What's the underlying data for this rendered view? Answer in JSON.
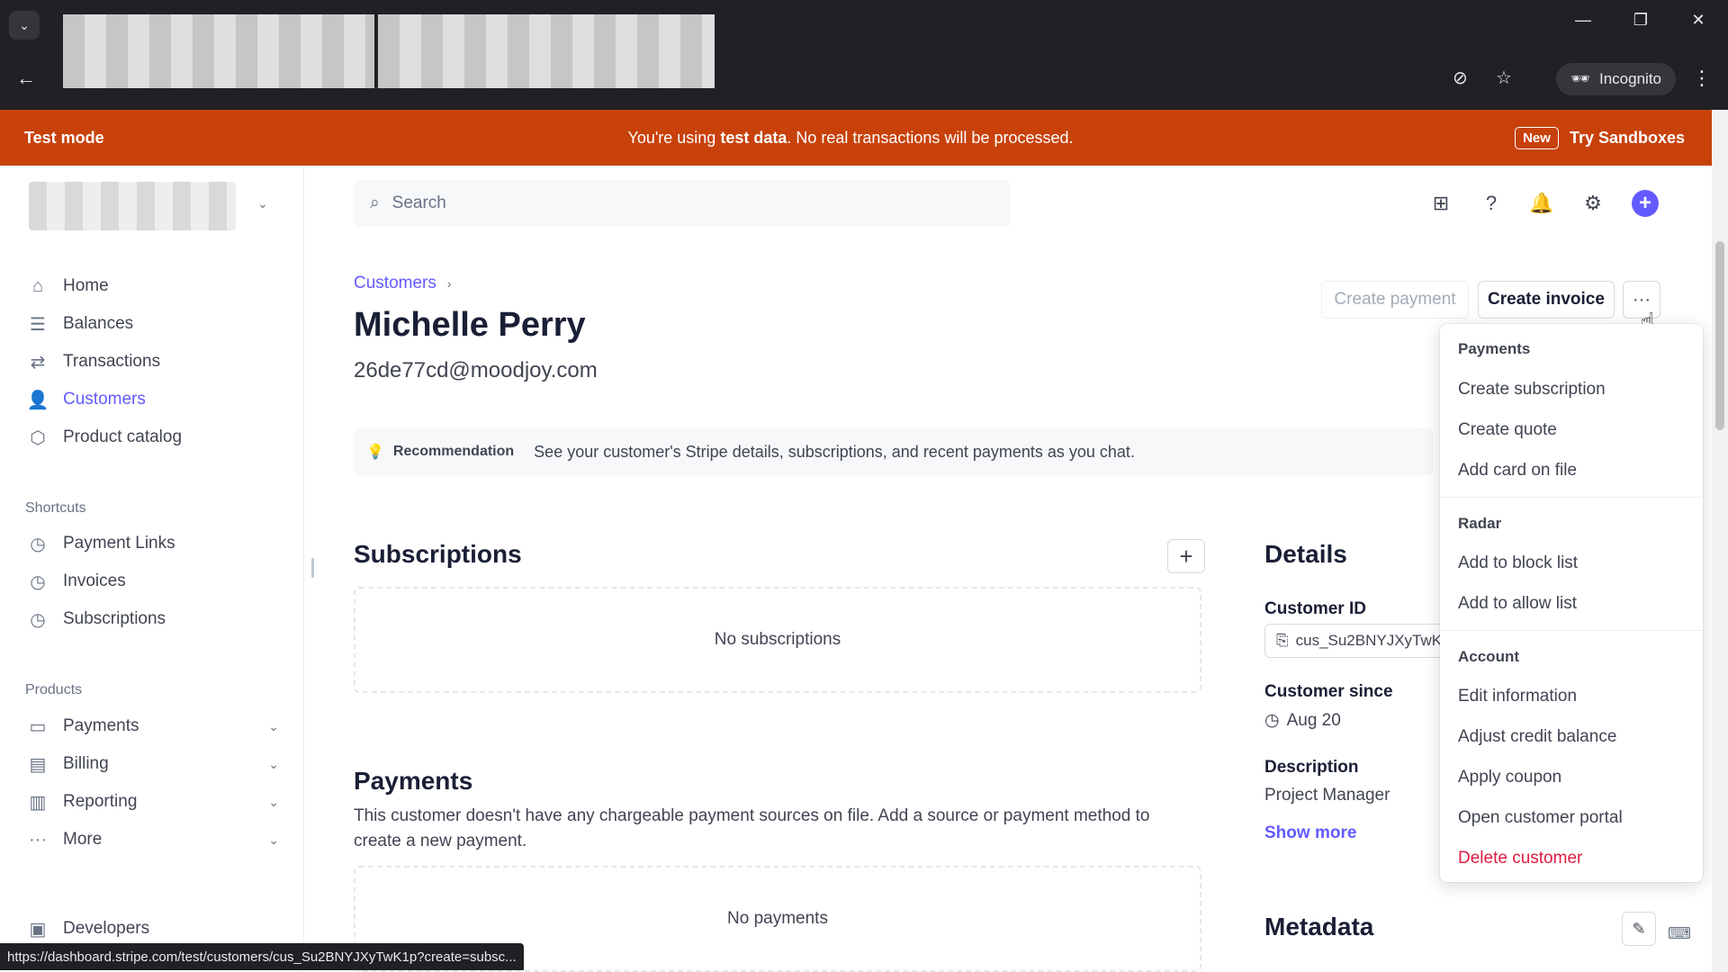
{
  "browser": {
    "incognito_label": "Incognito",
    "status_url": "https://dashboard.stripe.com/test/customers/cus_Su2BNYJXyTwK1p?create=subsc..."
  },
  "banner": {
    "left": "Test mode",
    "message_prefix": "You're using ",
    "message_bold": "test data",
    "message_suffix": ". No real transactions will be processed.",
    "new_badge": "New",
    "cta": "Try Sandboxes",
    "color": "#c8410b"
  },
  "sidebar": {
    "main_items": [
      {
        "label": "Home",
        "icon": "home-icon"
      },
      {
        "label": "Balances",
        "icon": "balances-icon"
      },
      {
        "label": "Transactions",
        "icon": "transactions-icon"
      },
      {
        "label": "Customers",
        "icon": "customers-icon",
        "active": true
      },
      {
        "label": "Product catalog",
        "icon": "product-catalog-icon"
      }
    ],
    "shortcuts_label": "Shortcuts",
    "shortcuts": [
      {
        "label": "Payment Links",
        "icon": "clock-icon"
      },
      {
        "label": "Invoices",
        "icon": "clock-icon"
      },
      {
        "label": "Subscriptions",
        "icon": "clock-icon"
      }
    ],
    "products_label": "Products",
    "products": [
      {
        "label": "Payments",
        "icon": "payments-icon"
      },
      {
        "label": "Billing",
        "icon": "billing-icon"
      },
      {
        "label": "Reporting",
        "icon": "reporting-icon"
      },
      {
        "label": "More",
        "icon": "more-icon"
      }
    ],
    "developers": "Developers"
  },
  "search": {
    "placeholder": "Search"
  },
  "breadcrumb": {
    "root": "Customers"
  },
  "customer": {
    "name": "Michelle Perry",
    "email": "26de77cd@moodjoy.com"
  },
  "actions": {
    "create_payment": "Create payment",
    "create_invoice": "Create invoice",
    "more": "···"
  },
  "recommendation": {
    "label": "Recommendation",
    "text": "See your customer's Stripe details, subscriptions, and recent payments as you chat."
  },
  "subscriptions": {
    "title": "Subscriptions",
    "empty": "No subscriptions"
  },
  "payments": {
    "title": "Payments",
    "description": "This customer doesn't have any chargeable payment sources on file. Add a source or payment method to create a new payment.",
    "empty": "No payments"
  },
  "details": {
    "title": "Details",
    "customer_id_label": "Customer ID",
    "customer_id": "cus_Su2BNYJXyTwK1",
    "customer_since_label": "Customer since",
    "customer_since": "Aug 20",
    "description_label": "Description",
    "description": "Project Manager",
    "show_more": "Show more"
  },
  "metadata": {
    "title": "Metadata"
  },
  "menu": {
    "groups": [
      {
        "title": "Payments",
        "items": [
          "Create subscription",
          "Create quote",
          "Add card on file"
        ]
      },
      {
        "title": "Radar",
        "items": [
          "Add to block list",
          "Add to allow list"
        ]
      },
      {
        "title": "Account",
        "items": [
          "Edit information",
          "Adjust credit balance",
          "Apply coupon",
          "Open customer portal",
          "Delete customer"
        ]
      }
    ]
  },
  "colors": {
    "accent": "#635bff",
    "danger": "#df1b41"
  }
}
